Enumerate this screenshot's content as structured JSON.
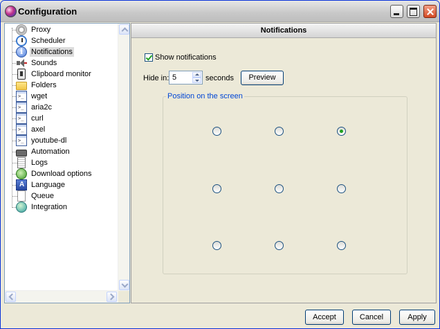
{
  "window": {
    "title": "Configuration"
  },
  "tree": {
    "items": [
      {
        "label": "Proxy",
        "icon": "gear-icon"
      },
      {
        "label": "Scheduler",
        "icon": "clock-icon"
      },
      {
        "label": "Notifications",
        "icon": "info-icon",
        "selected": true
      },
      {
        "label": "Sounds",
        "icon": "speaker-icon"
      },
      {
        "label": "Clipboard monitor",
        "icon": "clipboard-icon"
      },
      {
        "label": "Folders",
        "icon": "folder-icon"
      },
      {
        "label": "wget",
        "icon": "terminal-icon"
      },
      {
        "label": "aria2c",
        "icon": "terminal-icon"
      },
      {
        "label": "curl",
        "icon": "terminal-icon"
      },
      {
        "label": "axel",
        "icon": "terminal-icon"
      },
      {
        "label": "youtube-dl",
        "icon": "terminal-icon"
      },
      {
        "label": "Automation",
        "icon": "chip-icon"
      },
      {
        "label": "Logs",
        "icon": "log-icon"
      },
      {
        "label": "Download options",
        "icon": "download-options-icon"
      },
      {
        "label": "Language",
        "icon": "language-icon"
      },
      {
        "label": "Queue",
        "icon": "queue-icon"
      },
      {
        "label": "Integration",
        "icon": "integration-icon"
      }
    ]
  },
  "notifications": {
    "header": "Notifications",
    "show_label": "Show notifications",
    "show_checked": true,
    "hide_label": "Hide in:",
    "hide_value": "5",
    "seconds_label": "seconds",
    "preview_label": "Preview",
    "position_title": "Position on the screen",
    "selected_position": "top-right"
  },
  "footer": {
    "accept": "Accept",
    "cancel": "Cancel",
    "apply": "Apply"
  },
  "colors": {
    "accent": "#0046D5",
    "check": "#21A121"
  }
}
